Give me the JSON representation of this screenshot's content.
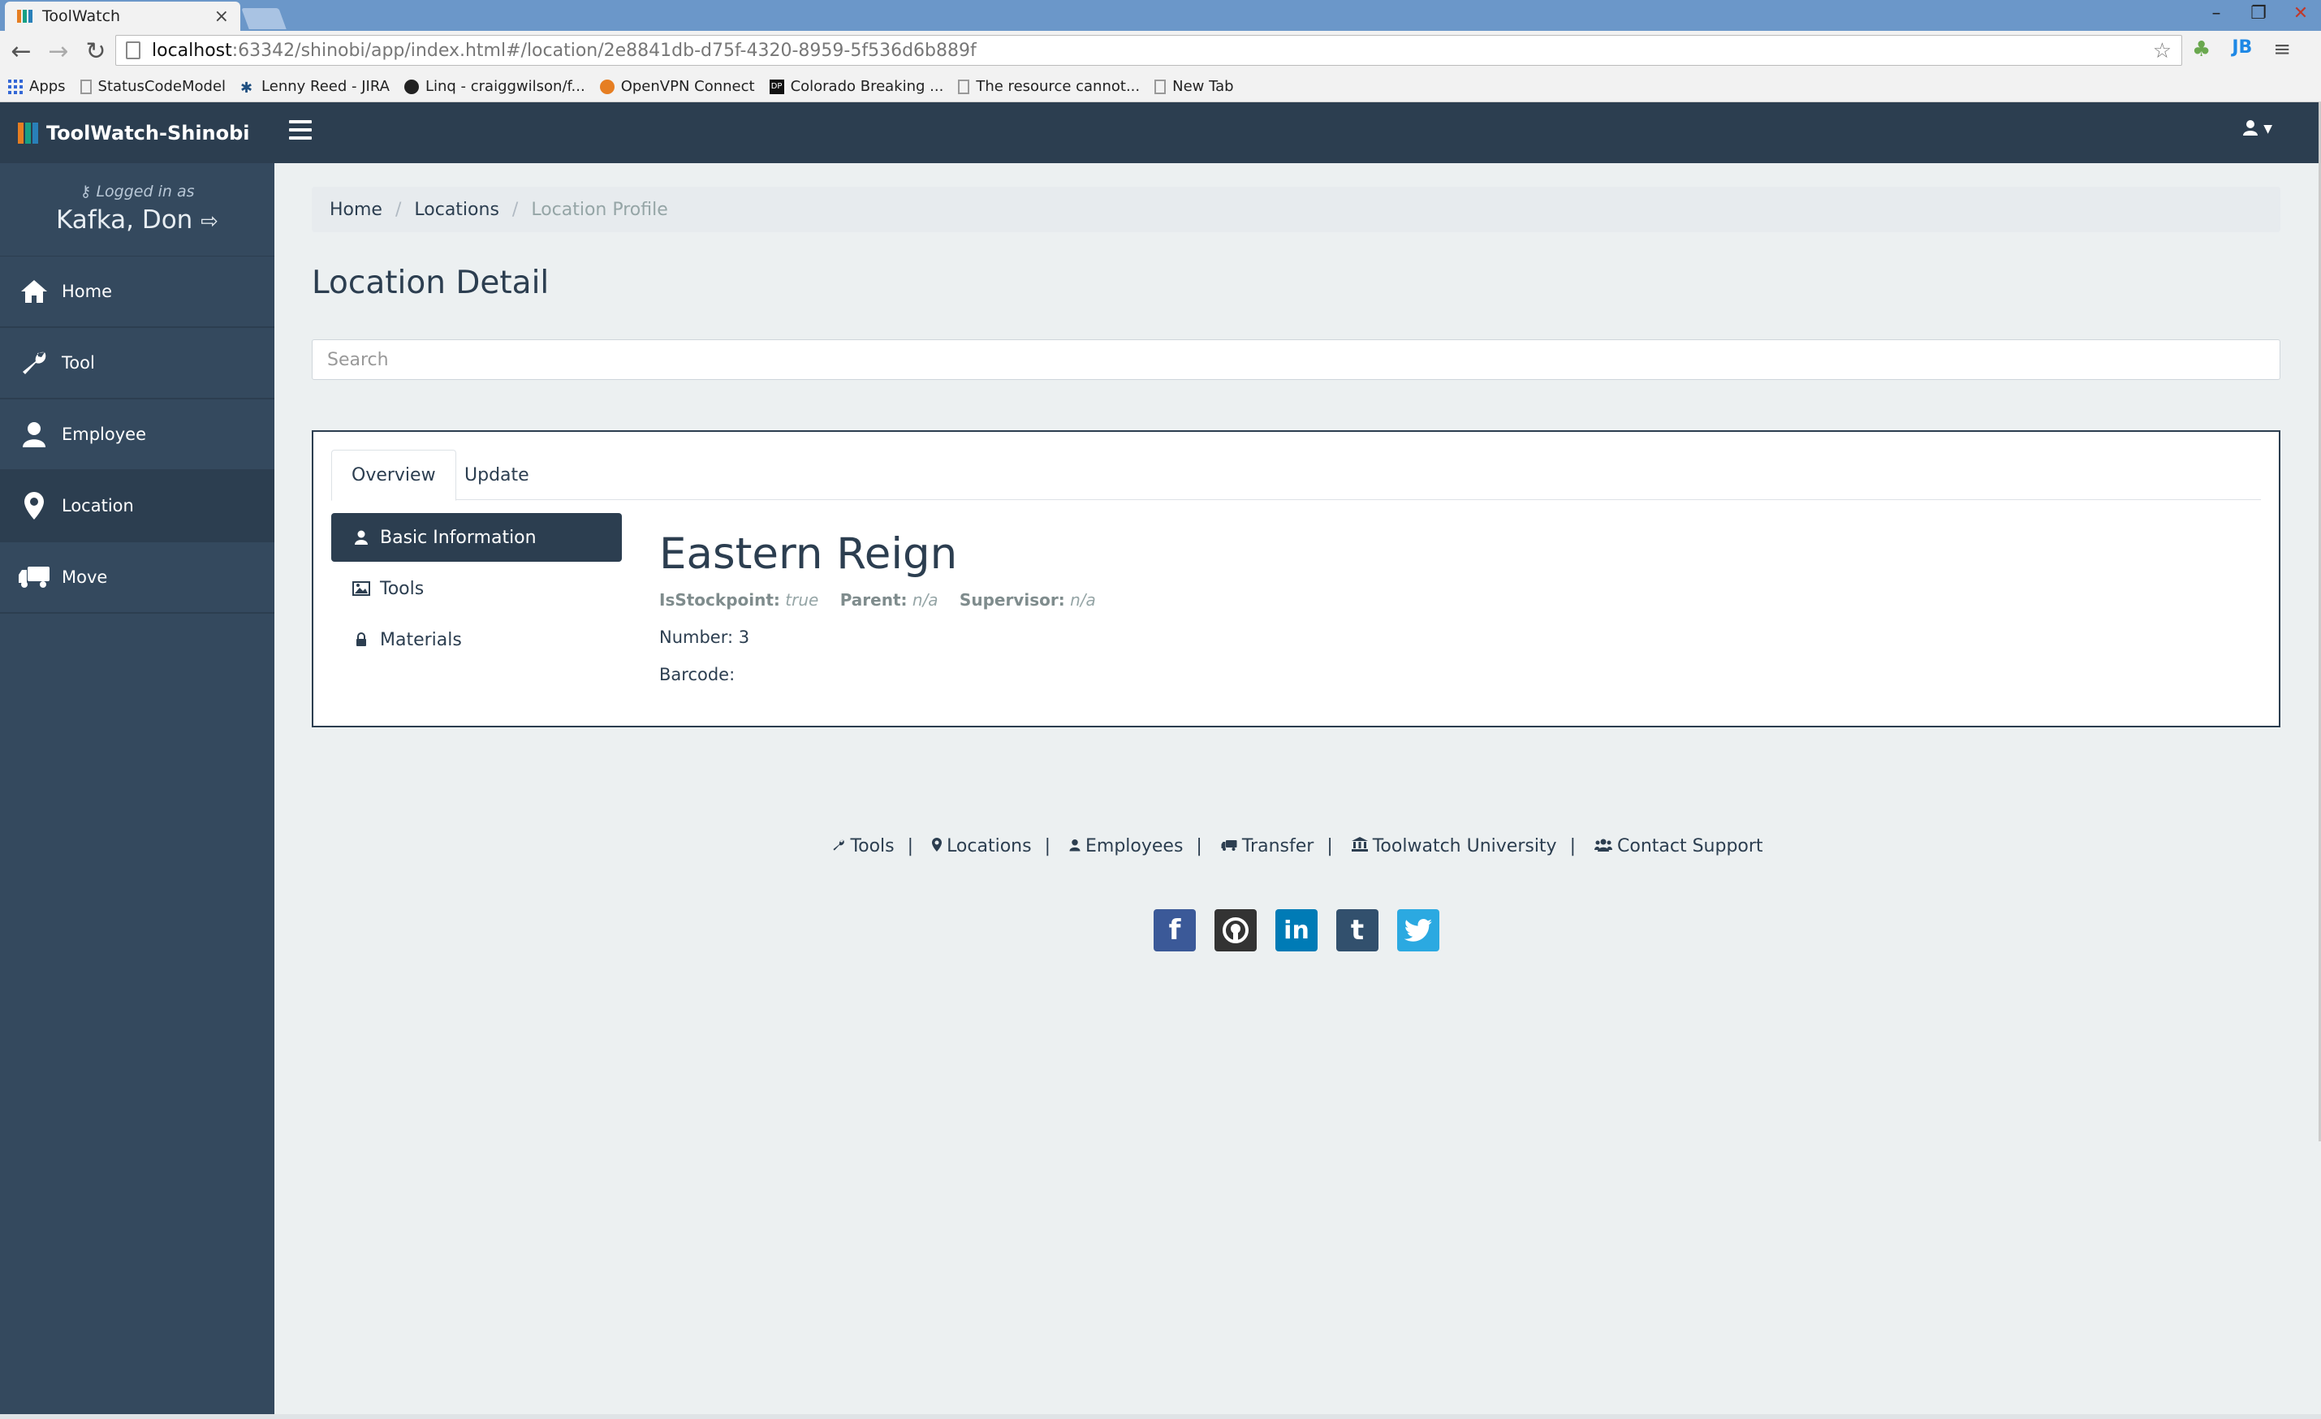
{
  "browser": {
    "tab_title": "ToolWatch",
    "tab_close": "×",
    "url_host": "localhost",
    "url_rest": ":63342/shinobi/app/index.html#/location/2e8841db-d75f-4320-8959-5f536d6b889f",
    "window_controls": {
      "minimize": "–",
      "restore": "❐",
      "close": "✕"
    },
    "bookmarks": [
      "Apps",
      "StatusCodeModel",
      "Lenny Reed - JIRA",
      "Linq - craiggwilson/f...",
      "OpenVPN Connect",
      "Colorado Breaking ...",
      "The resource cannot...",
      "New Tab"
    ]
  },
  "navbar": {
    "brand": "ToolWatch-Shinobi",
    "hamburger_icon": "hamburger-icon",
    "user_icon": "user-icon"
  },
  "sidebar": {
    "logged_in_label": "Logged in as",
    "user_name": "Kafka, Don",
    "items": [
      {
        "label": "Home",
        "icon": "home-icon",
        "active": false
      },
      {
        "label": "Tool",
        "icon": "wrench-icon",
        "active": false
      },
      {
        "label": "Employee",
        "icon": "user-icon",
        "active": false
      },
      {
        "label": "Location",
        "icon": "map-marker-icon",
        "active": true
      },
      {
        "label": "Move",
        "icon": "truck-icon",
        "active": false
      }
    ]
  },
  "breadcrumb": {
    "items": [
      "Home",
      "Locations"
    ],
    "current": "Location Profile"
  },
  "page": {
    "title": "Location Detail",
    "search_placeholder": "Search"
  },
  "panel": {
    "tabs": [
      "Overview",
      "Update"
    ],
    "active_tab": "Overview",
    "side_nav": [
      {
        "label": "Basic Information",
        "icon": "user-icon",
        "active": true
      },
      {
        "label": "Tools",
        "icon": "image-icon",
        "active": false
      },
      {
        "label": "Materials",
        "icon": "lock-icon",
        "active": false
      }
    ],
    "detail": {
      "name": "Eastern Reign",
      "is_stockpoint_label": "IsStockpoint:",
      "is_stockpoint_value": "true",
      "parent_label": "Parent:",
      "parent_value": "n/a",
      "supervisor_label": "Supervisor:",
      "supervisor_value": "n/a",
      "number_line": "Number: 3",
      "barcode_line": "Barcode:"
    }
  },
  "footer": {
    "links": [
      {
        "label": "Tools",
        "icon": "wrench-icon"
      },
      {
        "label": "Locations",
        "icon": "map-marker-icon"
      },
      {
        "label": "Employees",
        "icon": "user-icon"
      },
      {
        "label": "Transfer",
        "icon": "truck-icon"
      },
      {
        "label": "Toolwatch University",
        "icon": "university-icon"
      },
      {
        "label": "Contact Support",
        "icon": "users-icon"
      }
    ],
    "separator": "|",
    "socials": [
      {
        "name": "facebook-icon",
        "glyph": "f",
        "color": "#3b5998"
      },
      {
        "name": "github-icon",
        "glyph": "◉",
        "color": "#333333"
      },
      {
        "name": "linkedin-icon",
        "glyph": "in",
        "color": "#007bb6"
      },
      {
        "name": "tumblr-icon",
        "glyph": "t",
        "color": "#32506d"
      },
      {
        "name": "twitter-icon",
        "glyph": "🐦",
        "color": "#2ba9e1"
      }
    ]
  },
  "colors": {
    "navbar": "#2c3e50",
    "sidebar": "#34495e",
    "background": "#ecf0f1",
    "accent": "#2c3e50"
  }
}
